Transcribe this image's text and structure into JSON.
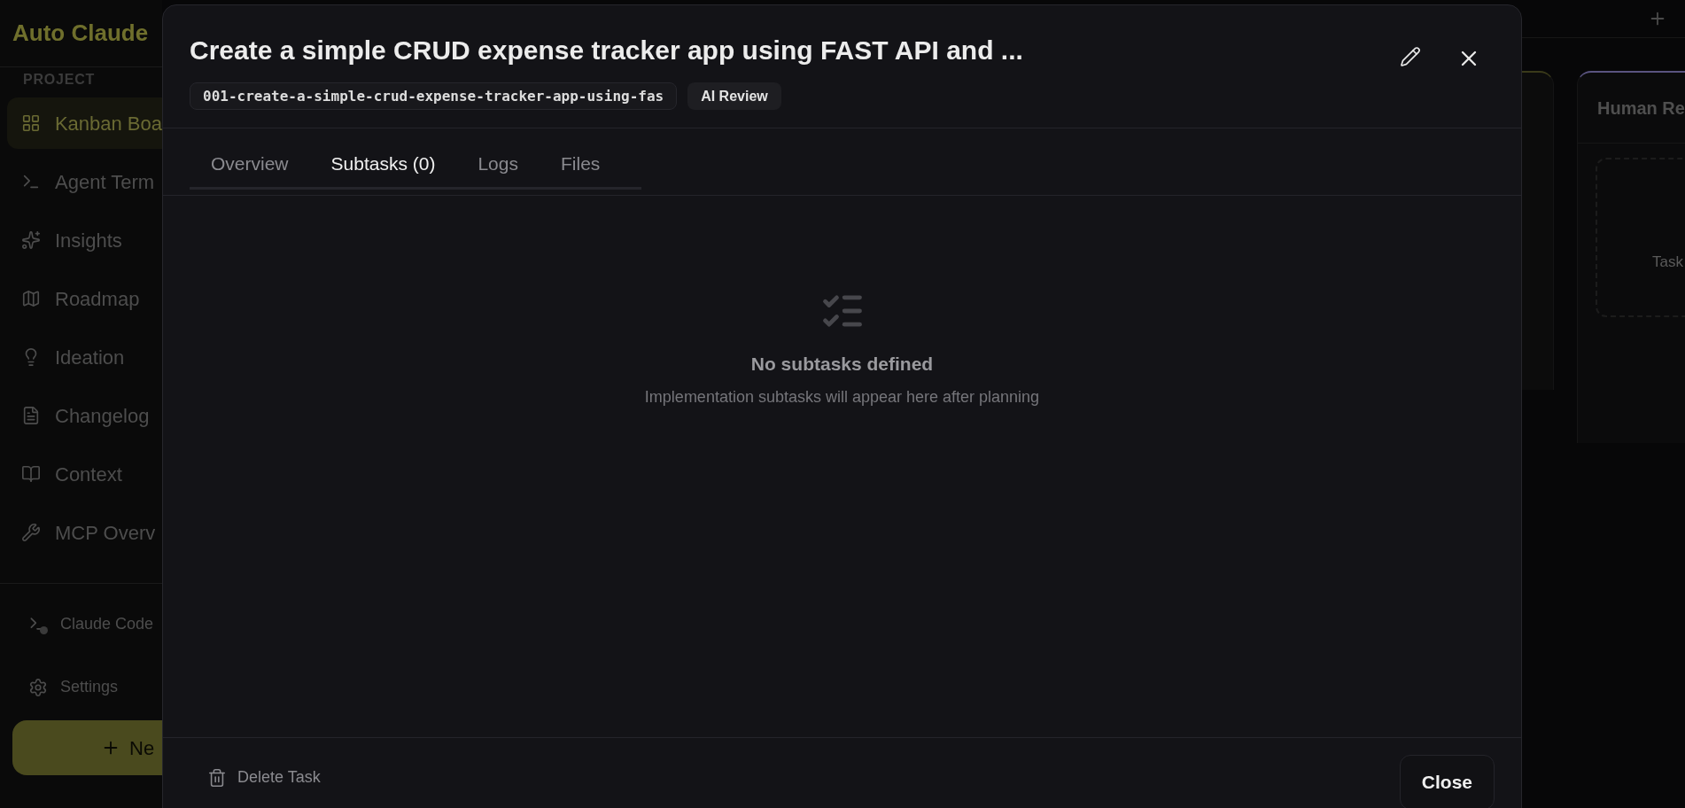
{
  "app": {
    "name": "Auto Claude"
  },
  "sidebar": {
    "section": "PROJECT",
    "items": [
      {
        "label": "Kanban Boa",
        "selected": true
      },
      {
        "label": "Agent Term",
        "selected": false
      },
      {
        "label": "Insights",
        "selected": false
      },
      {
        "label": "Roadmap",
        "selected": false
      },
      {
        "label": "Ideation",
        "selected": false
      },
      {
        "label": "Changelog",
        "selected": false
      },
      {
        "label": "Context",
        "selected": false
      },
      {
        "label": "MCP Overv",
        "selected": false
      }
    ],
    "bottom_items": [
      {
        "label": "Claude Code"
      },
      {
        "label": "Settings"
      }
    ],
    "new_button": "Ne"
  },
  "board": {
    "columns": [
      {
        "title": "Human Re",
        "placeholder": "Task",
        "color": "#5a5480"
      }
    ]
  },
  "dialog": {
    "title": "Create a simple CRUD expense tracker app using FAST API and ...",
    "id_badge": "001-create-a-simple-crud-expense-tracker-app-using-fas",
    "status_badge": "AI Review",
    "tabs": [
      {
        "label": "Overview",
        "selected": false
      },
      {
        "label": "Subtasks (0)",
        "selected": true
      },
      {
        "label": "Logs",
        "selected": false
      },
      {
        "label": "Files",
        "selected": false
      }
    ],
    "empty_title": "No subtasks defined",
    "empty_text": "Implementation subtasks will appear here after planning",
    "delete_button": "Delete Task",
    "close_button": "Close"
  }
}
